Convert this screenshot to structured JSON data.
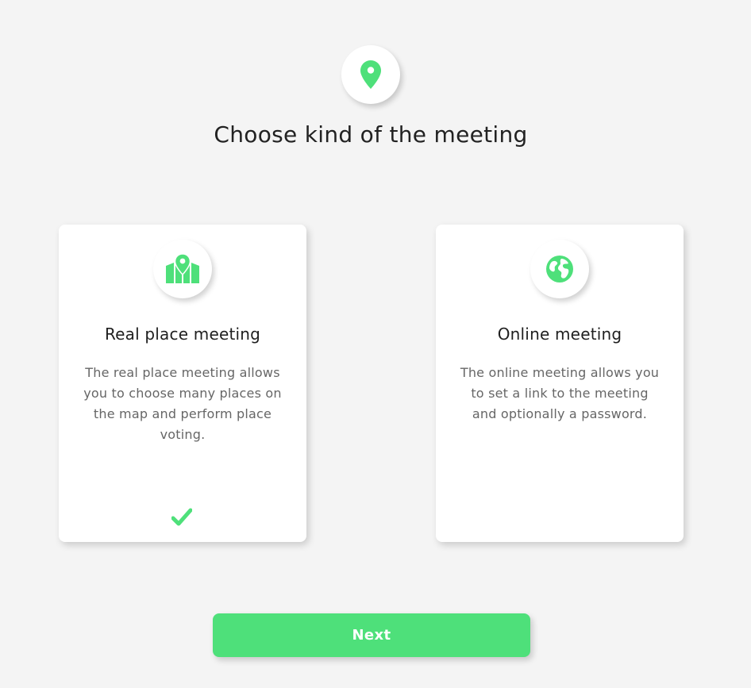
{
  "colors": {
    "accent": "#4ee07a",
    "background": "#f4f4f4"
  },
  "header": {
    "icon": "map-pin-icon",
    "title": "Choose kind of the meeting"
  },
  "options": [
    {
      "icon": "map-icon",
      "title": "Real place meeting",
      "description": "The real place meeting allows you to choose many places on the map and perform place voting.",
      "selected": true
    },
    {
      "icon": "globe-icon",
      "title": "Online meeting",
      "description": "The online meeting allows you to set a link to the meeting and optionally a password.",
      "selected": false
    }
  ],
  "actions": {
    "next_label": "Next"
  }
}
